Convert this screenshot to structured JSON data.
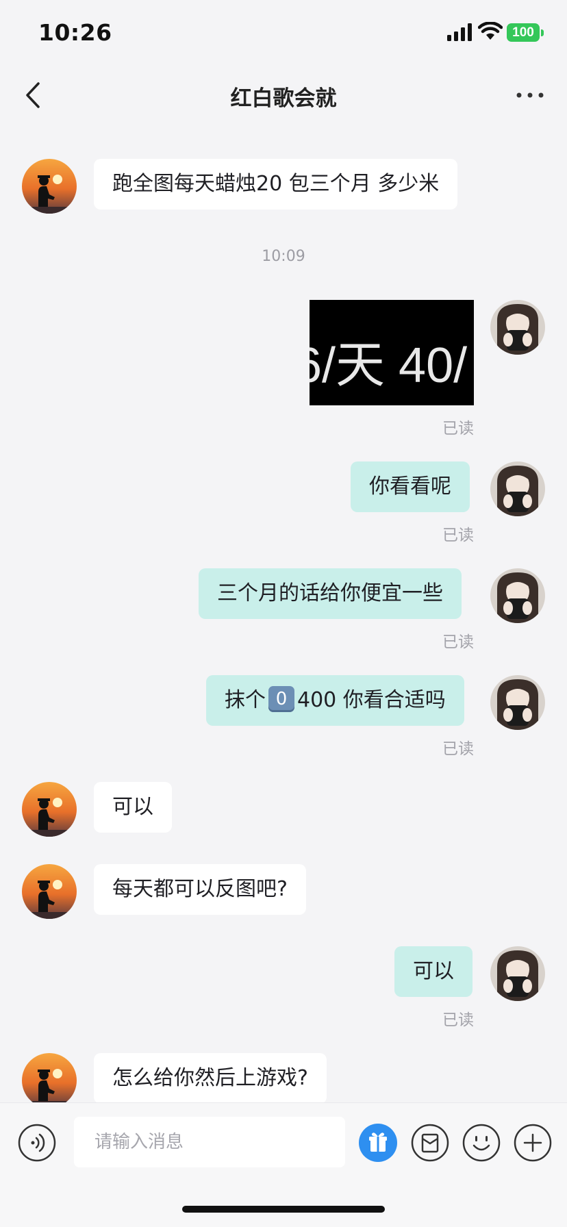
{
  "status_bar": {
    "time": "10:26",
    "battery": "100",
    "icons": [
      "signal-icon",
      "wifi-icon",
      "battery-icon"
    ]
  },
  "nav": {
    "title": "红白歌会就",
    "back_icon": "chevron-left-icon",
    "more_icon": "ellipsis-icon"
  },
  "messages": [
    {
      "from": "other",
      "text": "跑全图每天蜡烛20  包三个月 多少米"
    },
    {
      "type": "time",
      "text": "10:09"
    },
    {
      "from": "me",
      "type": "image",
      "image_text": "6/天 40/",
      "read": "已读"
    },
    {
      "from": "me",
      "text": "你看看呢",
      "read": "已读"
    },
    {
      "from": "me",
      "text": "三个月的话给你便宜一些",
      "read": "已读"
    },
    {
      "from": "me",
      "text_before": "抹个",
      "keycap": "0",
      "text_after": "400 你看合适吗",
      "read": "已读"
    },
    {
      "from": "other",
      "text": "可以"
    },
    {
      "from": "other",
      "text": "每天都可以反图吧?"
    },
    {
      "from": "me",
      "text": "可以",
      "read": "已读"
    },
    {
      "from": "other",
      "text": "怎么给你然后上游戏?"
    }
  ],
  "input_bar": {
    "placeholder": "请输入消息",
    "buttons": [
      "voice-icon",
      "gift-icon",
      "wallet-icon",
      "emoji-icon",
      "plus-icon"
    ]
  },
  "colors": {
    "background": "#f4f4f6",
    "incoming_bubble": "#ffffff",
    "outgoing_bubble": "#c9efea",
    "gift_button": "#2e8ff0",
    "battery": "#34c759"
  }
}
